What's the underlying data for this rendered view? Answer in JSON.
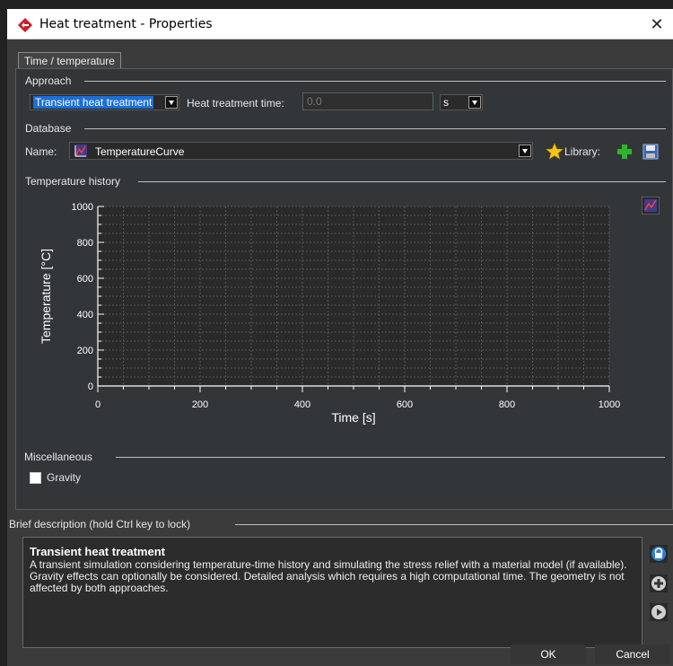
{
  "window": {
    "title": "Heat treatment - Properties",
    "close_glyph": "✕"
  },
  "tabs": [
    {
      "label": "Time / temperature"
    }
  ],
  "approach": {
    "section_label": "Approach",
    "type_value": "Transient heat treatment",
    "time_label": "Heat treatment time:",
    "time_value": "0.0",
    "unit_value": "s"
  },
  "database": {
    "section_label": "Database",
    "name_label": "Name:",
    "name_value": "TemperatureCurve",
    "library_label": "Library:"
  },
  "temperature_history": {
    "section_label": "Temperature history"
  },
  "chart_data": {
    "type": "line",
    "xlabel": "Time [s]",
    "ylabel": "Temperature [°C]",
    "xlim": [
      0,
      1000
    ],
    "ylim": [
      0,
      1000
    ],
    "x_ticks": [
      0,
      200,
      400,
      600,
      800,
      1000
    ],
    "y_ticks": [
      0,
      200,
      400,
      600,
      800,
      1000
    ],
    "grid": true,
    "series": []
  },
  "miscellaneous": {
    "section_label": "Miscellaneous",
    "gravity_label": "Gravity",
    "gravity_checked": false
  },
  "description": {
    "section_label": "Brief description (hold Ctrl key to lock)",
    "title": "Transient heat treatment",
    "text": "A transient simulation considering temperature-time history and simulating the stress relief with a material model (if available). Gravity effects can optionally be considered. Detailed analysis which requires a high computational time. The geometry is not affected by both approaches."
  },
  "buttons": {
    "ok": "OK",
    "cancel": "Cancel"
  },
  "colors": {
    "accent_selection": "#1b6fd6",
    "library_star": "#f5c518",
    "add_green": "#2db52d"
  },
  "icons": {
    "app": "app-logo-icon",
    "curve": "curve-icon",
    "library": "star-icon",
    "add": "plus-icon",
    "save": "save-icon",
    "lock": "lock-icon",
    "help": "info-icon",
    "play": "play-icon"
  }
}
